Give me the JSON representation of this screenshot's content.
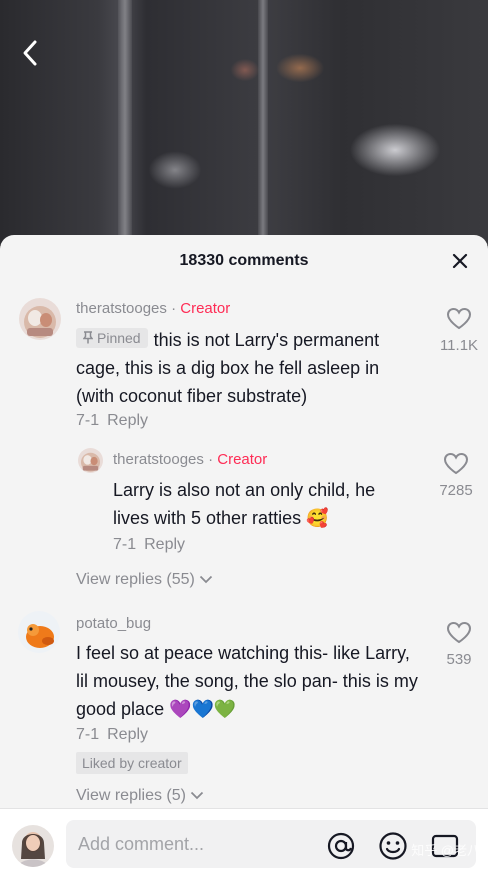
{
  "video": {
    "back_icon": "chevron-left-icon"
  },
  "sheet": {
    "title": "18330 comments",
    "close_icon": "close-icon"
  },
  "comments": [
    {
      "username": "theratstooges",
      "separator": " · ",
      "creator_tag": "Creator",
      "pinned_label": "Pinned",
      "text": "this is not Larry's permanent cage, this is a dig box he fell asleep in (with coconut fiber substrate)",
      "date": "7-1",
      "reply_label": "Reply",
      "likes": "11.1K",
      "reply": {
        "username": "theratstooges",
        "separator": " · ",
        "creator_tag": "Creator",
        "text": "Larry is also not an only child, he lives with 5 other ratties 🥰",
        "date": "7-1",
        "reply_label": "Reply",
        "likes": "7285"
      },
      "view_replies": "View replies (55)"
    },
    {
      "username": "potato_bug",
      "text": "I feel so at peace watching this- like Larry, lil mousey, the song, the slo pan- this is my good place 💜💙💚",
      "date": "7-1",
      "reply_label": "Reply",
      "likes": "539",
      "liked_by": "Liked by creator",
      "view_replies": "View replies (5)"
    }
  ],
  "input": {
    "placeholder": "Add comment...",
    "icons": [
      "at-icon",
      "emoji-icon",
      "image-icon"
    ]
  },
  "watermark": "知乎 @老八"
}
